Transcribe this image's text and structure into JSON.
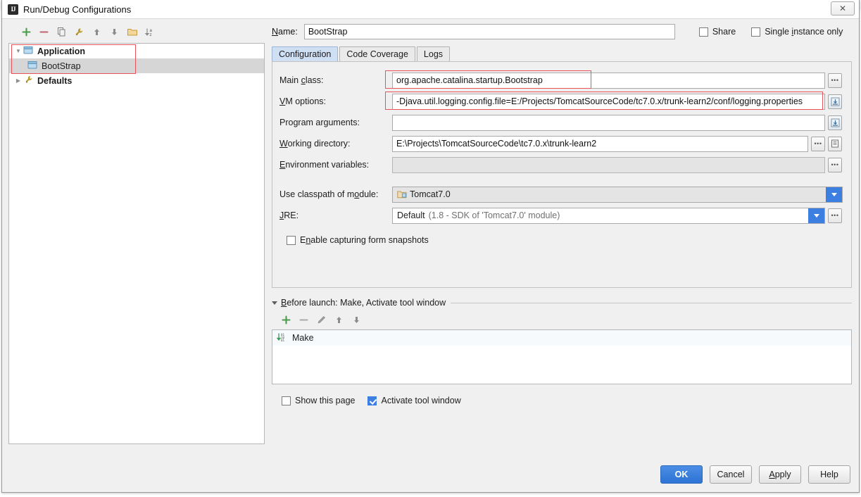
{
  "window": {
    "title": "Run/Debug Configurations",
    "icon": "intellij-idea-icon",
    "close_label": "✕"
  },
  "toolbar": {
    "items": [
      {
        "name": "add-configuration-button",
        "icon": "plus-icon",
        "glyph": "+"
      },
      {
        "name": "remove-configuration-button",
        "icon": "minus-icon",
        "glyph": "–"
      },
      {
        "name": "copy-configuration-button",
        "icon": "copy-icon",
        "glyph": "❐"
      },
      {
        "name": "edit-defaults-button",
        "icon": "wrench-icon",
        "glyph": "⚒"
      },
      {
        "name": "move-up-button",
        "icon": "arrow-up-icon",
        "glyph": "↑"
      },
      {
        "name": "move-down-button",
        "icon": "arrow-down-icon",
        "glyph": "↓"
      },
      {
        "name": "create-folder-button",
        "icon": "folder-icon",
        "glyph": "▭"
      },
      {
        "name": "sort-configurations-button",
        "icon": "sort-az-icon",
        "glyph": "↓az"
      }
    ]
  },
  "tree": {
    "nodes": [
      {
        "label": "Application",
        "icon": "application-icon",
        "expanded": true,
        "bold": true,
        "indent": false,
        "selected": false
      },
      {
        "label": "BootStrap",
        "icon": "application-icon",
        "expanded": null,
        "bold": false,
        "indent": true,
        "selected": true
      },
      {
        "label": "Defaults",
        "icon": "defaults-icon",
        "expanded": false,
        "bold": true,
        "indent": false,
        "selected": false
      }
    ]
  },
  "form": {
    "name_label": "Name:",
    "name_value": "BootStrap",
    "share_label": "Share",
    "share_checked": false,
    "single_instance_label": "Single instance only",
    "single_instance_checked": false
  },
  "tabs": [
    {
      "label": "Configuration",
      "active": true
    },
    {
      "label": "Code Coverage",
      "active": false
    },
    {
      "label": "Logs",
      "active": false
    }
  ],
  "config": {
    "main_class_label": "Main class:",
    "main_class_value": "org.apache.catalina.startup.Bootstrap",
    "vm_options_label": "VM options:",
    "vm_options_value": "-Djava.util.logging.config.file=E:/Projects/TomcatSourceCode/tc7.0.x/trunk-learn2/conf/logging.properties",
    "program_arguments_label": "Program arguments:",
    "program_arguments_value": "",
    "working_directory_label": "Working directory:",
    "working_directory_value": "E:\\Projects\\TomcatSourceCode\\tc7.0.x\\trunk-learn2",
    "environment_variables_label": "Environment variables:",
    "environment_variables_value": "",
    "use_classpath_label": "Use classpath of module:",
    "use_classpath_value": "Tomcat7.0",
    "jre_label": "JRE:",
    "jre_value": "Default",
    "jre_hint": "(1.8 - SDK of 'Tomcat7.0' module)",
    "enable_snapshots_label": "Enable capturing form snapshots",
    "enable_snapshots_checked": false,
    "browse_glyph": "•••",
    "expand_glyph": "❐",
    "macro_glyph": "▤"
  },
  "before_launch": {
    "title": "Before launch: Make, Activate tool window",
    "toolbar": [
      {
        "name": "before-launch-add-button",
        "icon": "plus-icon",
        "glyph": "+"
      },
      {
        "name": "before-launch-remove-button",
        "icon": "minus-icon",
        "glyph": "–"
      },
      {
        "name": "before-launch-edit-button",
        "icon": "pencil-icon",
        "glyph": "✎"
      },
      {
        "name": "before-launch-move-up-button",
        "icon": "arrow-up-icon",
        "glyph": "↑"
      },
      {
        "name": "before-launch-move-down-button",
        "icon": "arrow-down-icon",
        "glyph": "↓"
      }
    ],
    "tasks": [
      {
        "label": "Make",
        "icon": "make-build-icon"
      }
    ],
    "show_page_label": "Show this page",
    "show_page_checked": false,
    "activate_tool_window_label": "Activate tool window",
    "activate_tool_window_checked": true
  },
  "buttons": {
    "ok": "OK",
    "cancel": "Cancel",
    "apply": "Apply",
    "help": "Help"
  },
  "colors": {
    "accent_blue": "#3c7fe0",
    "annotation_red": "#e8535a",
    "active_tab_blue": "#cfe0f5",
    "selection_gray": "#d6d6d6"
  }
}
